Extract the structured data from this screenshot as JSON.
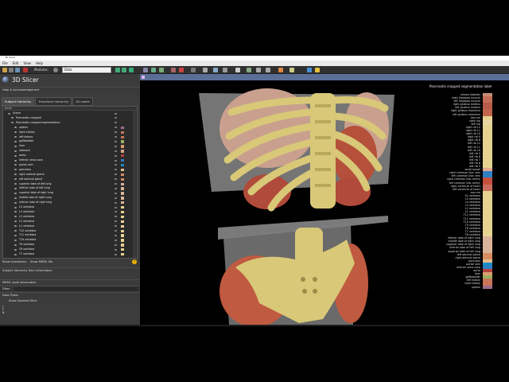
{
  "window": {
    "title": "3D Slicer"
  },
  "menu": [
    "File",
    "Edit",
    "View",
    "Help"
  ],
  "toolbar": {
    "module_label": "Modules:",
    "module_value": "Data"
  },
  "panel": {
    "app_title": "3D Slicer",
    "help_section": "Help & Acknowledgement",
    "tabs": [
      "Subject hierarchy",
      "Transform hierarchy",
      "All nodes"
    ],
    "tree_header": "Node",
    "tree_items": [
      {
        "label": "Scene",
        "color": null
      },
      {
        "label": "Pancreatic-cropped",
        "color": null
      },
      {
        "label": "Pancreatic-cropped segmentation",
        "color": null
      },
      {
        "label": "spleen",
        "color": "#9d6b8f"
      },
      {
        "label": "right kidney",
        "color": "#c8755a"
      },
      {
        "label": "left kidney",
        "color": "#c8755a"
      },
      {
        "label": "gallbladder",
        "color": "#9ab060"
      },
      {
        "label": "liver",
        "color": "#d9a06e"
      },
      {
        "label": "stomach",
        "color": "#d6a488"
      },
      {
        "label": "aorta",
        "color": "#b5413e"
      },
      {
        "label": "inferior vena cava",
        "color": "#2f7fc4"
      },
      {
        "label": "portal vein",
        "color": "#1a8ec8"
      },
      {
        "label": "pancreas",
        "color": "#e6bb8c"
      },
      {
        "label": "right adrenal gland",
        "color": "#d68d62"
      },
      {
        "label": "left adrenal gland",
        "color": "#d68d62"
      },
      {
        "label": "superior lobe of left lung",
        "color": "#d9b49a"
      },
      {
        "label": "inferior lobe of left lung",
        "color": "#d9b49a"
      },
      {
        "label": "superior lobe of right lung",
        "color": "#d9b49a"
      },
      {
        "label": "middle lobe of right lung",
        "color": "#d9b49a"
      },
      {
        "label": "inferior lobe of right lung",
        "color": "#d9b49a"
      },
      {
        "label": "L5 vertebra",
        "color": "#e6d391"
      },
      {
        "label": "L4 vertebra",
        "color": "#e6d391"
      },
      {
        "label": "L3 vertebra",
        "color": "#e6d391"
      },
      {
        "label": "L2 vertebra",
        "color": "#e6d391"
      },
      {
        "label": "L1 vertebra",
        "color": "#e6d391"
      },
      {
        "label": "T12 vertebra",
        "color": "#e6d391"
      },
      {
        "label": "T11 vertebra",
        "color": "#e6d391"
      },
      {
        "label": "T10 vertebra",
        "color": "#e6d391"
      },
      {
        "label": "T9 vertebra",
        "color": "#e6d391"
      },
      {
        "label": "T8 vertebra",
        "color": "#e6d391"
      },
      {
        "label": "T7 vertebra",
        "color": "#e6d391"
      }
    ],
    "show_transforms": "Show transforms",
    "show_mrml_ids": "Show MRML IDs",
    "subject_info": "Subject hierarchy item information",
    "mrml_info": "MRML node information",
    "filter": "Filter:",
    "data_probe": "Data Probe",
    "show_zoomed": "Show Zoomed Slice",
    "probe_lines": [
      "L",
      "F",
      "B"
    ]
  },
  "view": {
    "legend_title": "Pancreatic-cropped segmentation label",
    "legend": [
      {
        "label": "urinary bladder",
        "color": "#c88c78"
      },
      {
        "label": "right iliopsoas muscle",
        "color": "#c46e5a"
      },
      {
        "label": "left iliopsoas muscle",
        "color": "#c46e5a"
      },
      {
        "label": "right gluteus medius",
        "color": "#b85a48"
      },
      {
        "label": "left gluteus medius",
        "color": "#b85a48"
      },
      {
        "label": "right gluteus maximus",
        "color": "#c0644c"
      },
      {
        "label": "left gluteus maximus",
        "color": "#c0644c"
      },
      {
        "label": "sacrum",
        "color": "#e6d391"
      },
      {
        "label": "right hip",
        "color": "#e8d5a0"
      },
      {
        "label": "left hip",
        "color": "#e8d5a0"
      },
      {
        "label": "right rib 12",
        "color": "#e6d391"
      },
      {
        "label": "right rib 11",
        "color": "#e6d391"
      },
      {
        "label": "right rib 10",
        "color": "#e6d391"
      },
      {
        "label": "right rib 9",
        "color": "#e6d391"
      },
      {
        "label": "right rib 8",
        "color": "#e6d391"
      },
      {
        "label": "left rib 12",
        "color": "#e6d391"
      },
      {
        "label": "left rib 11",
        "color": "#e6d391"
      },
      {
        "label": "left rib 10",
        "color": "#e6d391"
      },
      {
        "label": "left rib 9",
        "color": "#e6d391"
      },
      {
        "label": "left rib 8",
        "color": "#e6d391"
      },
      {
        "label": "left rib 7",
        "color": "#e6d391"
      },
      {
        "label": "left rib 6",
        "color": "#e6d391"
      },
      {
        "label": "left rib 5",
        "color": "#e6d391"
      },
      {
        "label": "small bowel",
        "color": "#e0a890"
      },
      {
        "label": "right common iliac vein",
        "color": "#2f7fc4"
      },
      {
        "label": "left common iliac vein",
        "color": "#2f7fc4"
      },
      {
        "label": "right common iliac artery",
        "color": "#c8503e"
      },
      {
        "label": "left common iliac artery",
        "color": "#c8503e"
      },
      {
        "label": "right ventricle of heart",
        "color": "#c86e5e"
      },
      {
        "label": "left ventricle of heart",
        "color": "#c86e5e"
      },
      {
        "label": "sacrum",
        "color": "#e6d391"
      },
      {
        "label": "S1 vertebra",
        "color": "#e6d391"
      },
      {
        "label": "L5 vertebra",
        "color": "#e6d391"
      },
      {
        "label": "L4 vertebra",
        "color": "#e6d391"
      },
      {
        "label": "L3 vertebra",
        "color": "#e6d391"
      },
      {
        "label": "L2 vertebra",
        "color": "#e6d391"
      },
      {
        "label": "L1 vertebra",
        "color": "#e6d391"
      },
      {
        "label": "T12 vertebra",
        "color": "#e6d391"
      },
      {
        "label": "T11 vertebra",
        "color": "#e6d391"
      },
      {
        "label": "T10 vertebra",
        "color": "#e6d391"
      },
      {
        "label": "T9 vertebra",
        "color": "#e6d391"
      },
      {
        "label": "T8 vertebra",
        "color": "#e6d391"
      },
      {
        "label": "T7 vertebra",
        "color": "#e6d391"
      },
      {
        "label": "T6 vertebra",
        "color": "#e6d391"
      },
      {
        "label": "inferior lobe of right lung",
        "color": "#d9b49a"
      },
      {
        "label": "middle lobe of right lung",
        "color": "#d9b49a"
      },
      {
        "label": "superior lobe of right lung",
        "color": "#d9b49a"
      },
      {
        "label": "inferior lobe of left lung",
        "color": "#d9b49a"
      },
      {
        "label": "superior lobe of left lung",
        "color": "#d9b49a"
      },
      {
        "label": "left adrenal gland",
        "color": "#d68d62"
      },
      {
        "label": "right adrenal gland",
        "color": "#d68d62"
      },
      {
        "label": "pancreas",
        "color": "#e6bb8c"
      },
      {
        "label": "portal vein",
        "color": "#1a8ec8"
      },
      {
        "label": "inferior vena cava",
        "color": "#2f7fc4"
      },
      {
        "label": "aorta",
        "color": "#b5413e"
      },
      {
        "label": "liver",
        "color": "#d9a06e"
      },
      {
        "label": "gallbladder",
        "color": "#9ab060"
      },
      {
        "label": "left kidney",
        "color": "#c8755a"
      },
      {
        "label": "right kidney",
        "color": "#c8755a"
      },
      {
        "label": "spleen",
        "color": "#9d6b8f"
      }
    ]
  }
}
